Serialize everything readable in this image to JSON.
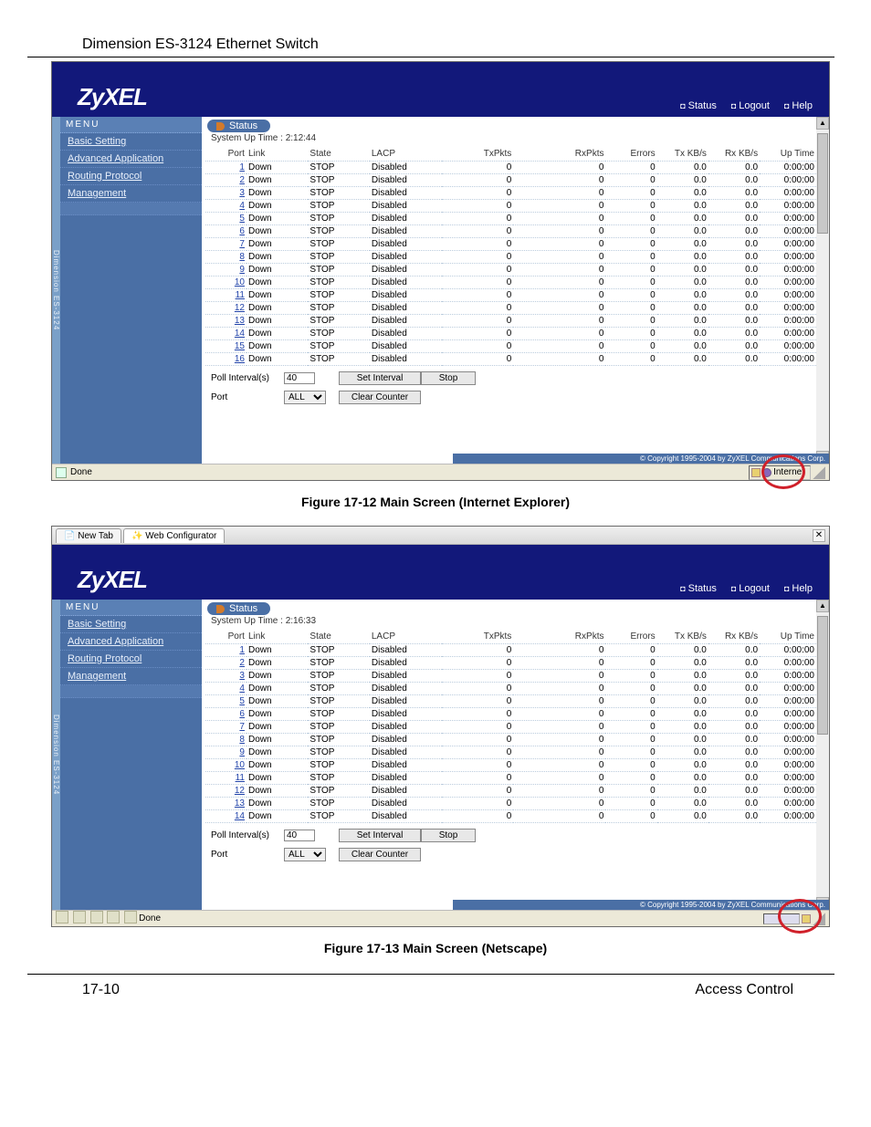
{
  "page_title": "Dimension ES-3124 Ethernet Switch",
  "page_number": "17-10",
  "section": "Access Control",
  "caption1": "Figure 17-12 Main Screen (Internet Explorer)",
  "caption2": "Figure 17-13 Main Screen (Netscape)",
  "logo": "ZyXEL",
  "toplinks": {
    "status": "Status",
    "logout": "Logout",
    "help": "Help"
  },
  "sidebar_strip": "Dimension ES-3124",
  "menu_header": "MENU",
  "menu_items": [
    "Basic Setting",
    "Advanced Application",
    "Routing Protocol",
    "Management"
  ],
  "status_label": "Status",
  "uptime_label": "System Up Time :",
  "uptime1": "2:12:44",
  "uptime2": "2:16:33",
  "cols": [
    "Port",
    "Link",
    "State",
    "LACP",
    "TxPkts",
    "RxPkts",
    "Errors",
    "Tx KB/s",
    "Rx KB/s",
    "Up Time"
  ],
  "rows1_16": {
    "link": "Down",
    "state": "STOP",
    "lacp": "Disabled",
    "tx": "0",
    "rx": "0",
    "err": "0",
    "txk": "0.0",
    "rxk": "0.0",
    "ut": "0:00:00"
  },
  "rows": [
    1,
    2,
    3,
    4,
    5,
    6,
    7,
    8,
    9,
    10,
    11,
    12,
    13,
    14,
    15,
    16
  ],
  "rows2": [
    1,
    2,
    3,
    4,
    5,
    6,
    7,
    8,
    9,
    10,
    11,
    12,
    13,
    14
  ],
  "controls": {
    "poll_label": "Poll Interval(s)",
    "poll_value": "40",
    "set_interval": "Set Interval",
    "stop": "Stop",
    "port_label": "Port",
    "port_select": "ALL",
    "clear": "Clear Counter"
  },
  "copyright": "© Copyright 1995-2004 by ZyXEL Communications Corp.",
  "ie_status": "Done",
  "ie_zone": "Internet",
  "ns_tab1": "New Tab",
  "ns_tab2": "Web Configurator",
  "ns_status": "Done"
}
